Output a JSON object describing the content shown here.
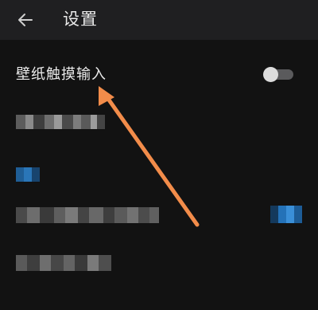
{
  "header": {
    "back_icon": "arrow-left-icon",
    "title": "设置"
  },
  "setting": {
    "label": "壁纸触摸输入",
    "enabled": false
  },
  "colors": {
    "background": "#121212",
    "appbar": "#1f1f21",
    "arrow": "#f28c4a",
    "accent_blue": "#1e73c8"
  }
}
